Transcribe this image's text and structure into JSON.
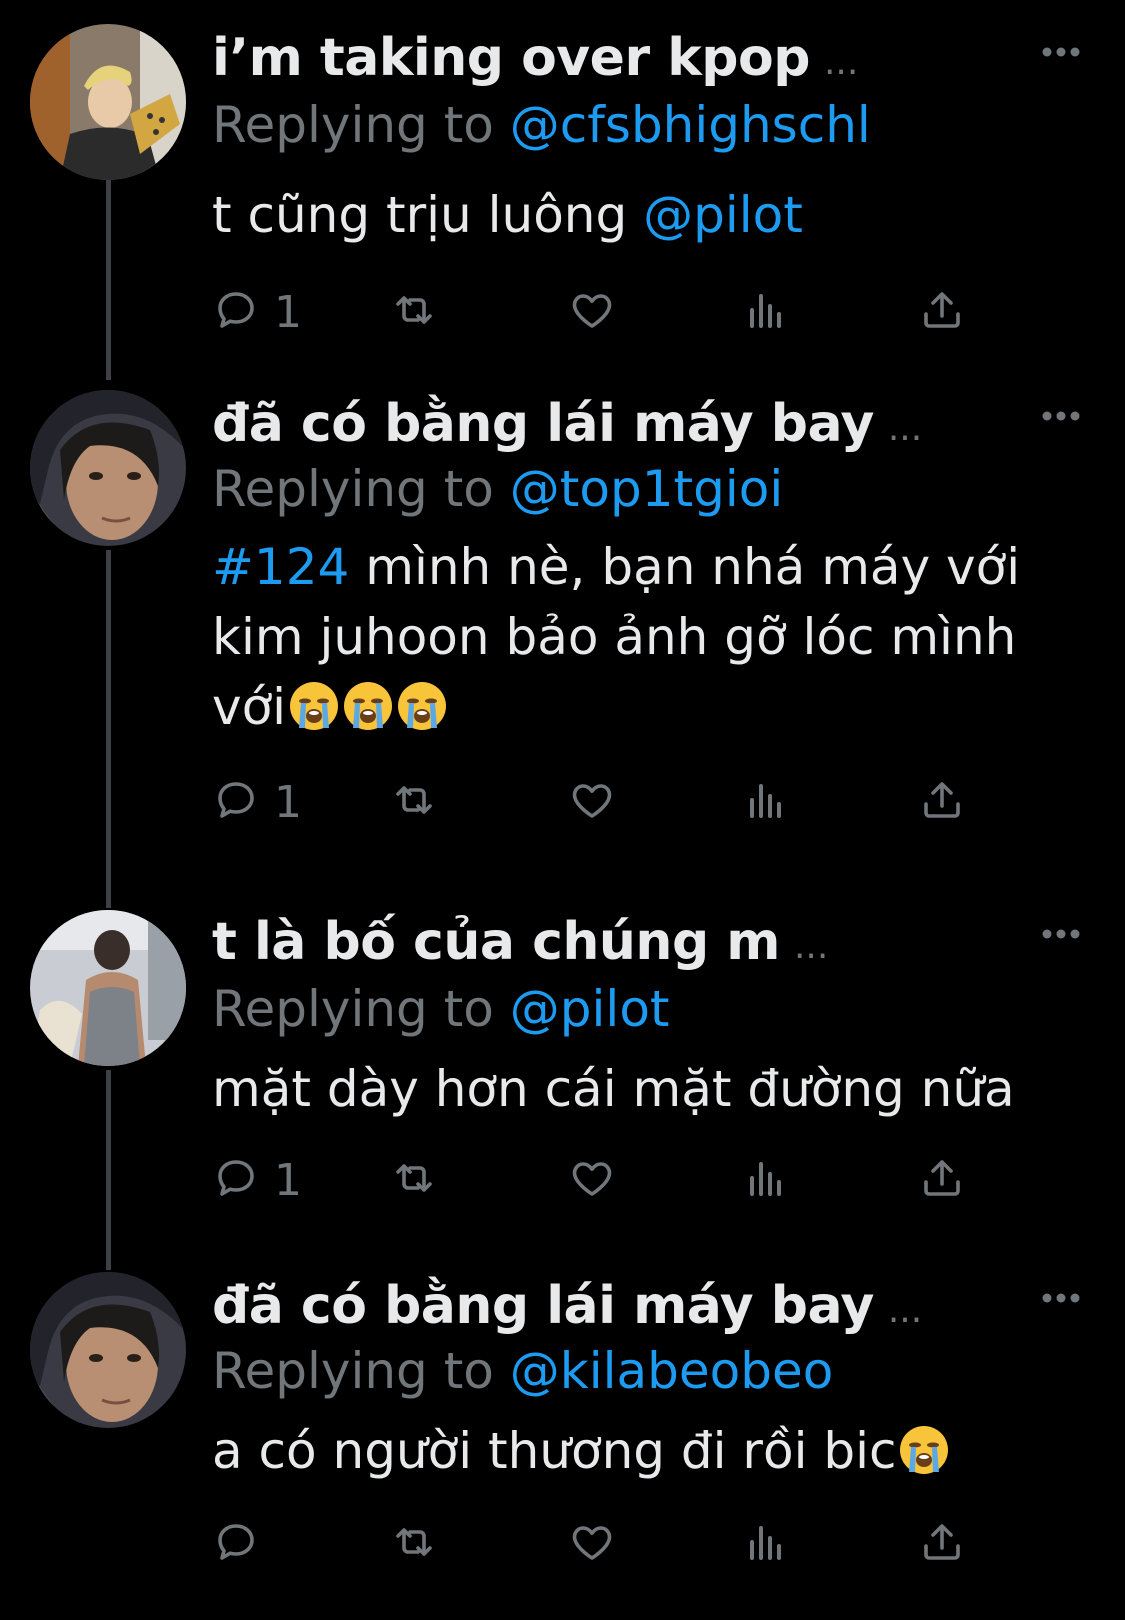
{
  "tweets": [
    {
      "name": "i’m taking over kpop",
      "ellipsis": "...",
      "replying_prefix": "Replying to",
      "replying_handle": "@cfsbhighschl",
      "body_parts": [
        {
          "text": "t cũng trịu luông ",
          "kind": "text"
        },
        {
          "text": "@pilot",
          "kind": "mention"
        }
      ],
      "reply_count": "1",
      "avatar": "blonde-person-photo"
    },
    {
      "name": "đã có bằng lái máy bay",
      "ellipsis": "...",
      "replying_prefix": "Replying to",
      "replying_handle": "@top1tgioi",
      "body_parts": [
        {
          "text": "#124",
          "kind": "mention"
        },
        {
          "text": " mình nè, bạn nhá máy với kim juhoon bảo ảnh gỡ lóc mình với",
          "kind": "text"
        }
      ],
      "emoji_count": 3,
      "emoji": "loudly-crying-face-emoji",
      "reply_count": "1",
      "avatar": "face-selfie-photo"
    },
    {
      "name": "t là bố của chúng m",
      "ellipsis": "...",
      "replying_prefix": "Replying to",
      "replying_handle": "@pilot",
      "body_parts": [
        {
          "text": "mặt dày hơn cái mặt đường nữa",
          "kind": "text"
        }
      ],
      "reply_count": "1",
      "avatar": "back-view-photo"
    },
    {
      "name": "đã có bằng lái máy bay",
      "ellipsis": "...",
      "replying_prefix": "Replying to",
      "replying_handle": "@kilabeobeo",
      "body_parts": [
        {
          "text": "a có người thương đi rồi bic",
          "kind": "text"
        }
      ],
      "emoji_count": 1,
      "emoji": "loudly-crying-face-emoji",
      "reply_count": "",
      "avatar": "face-selfie-photo"
    }
  ],
  "icons": {
    "reply": "reply-icon",
    "retweet": "retweet-icon",
    "like": "like-icon",
    "views": "views-icon",
    "share": "share-icon",
    "more": "more-icon"
  },
  "colors": {
    "background": "#000000",
    "text": "#e7e9ea",
    "secondary": "#71767b",
    "accent": "#1d9bf0",
    "thread_line": "#3d4145"
  }
}
